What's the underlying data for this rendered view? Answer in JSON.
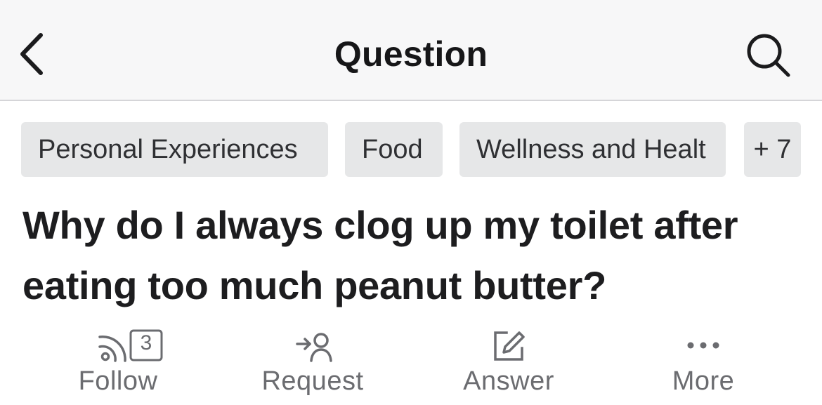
{
  "header": {
    "title": "Question",
    "back_icon": "chevron-left-icon",
    "search_icon": "search-icon"
  },
  "topics": [
    {
      "label": "Personal Experiences"
    },
    {
      "label": "Food"
    },
    {
      "label": "Wellness and Healt"
    },
    {
      "label": "+ 7"
    }
  ],
  "question": {
    "title": "Why do I always clog up my toilet after eating too much peanut butter?"
  },
  "actions": {
    "follow": {
      "label": "Follow",
      "count": "3",
      "icon": "follow-feed-icon"
    },
    "request": {
      "label": "Request",
      "icon": "request-person-icon"
    },
    "answer": {
      "label": "Answer",
      "icon": "answer-pencil-icon"
    },
    "more": {
      "label": "More",
      "icon": "more-dots-icon"
    }
  },
  "colors": {
    "header_bg": "#f7f7f8",
    "chip_bg": "#e6e7e8",
    "action_gray": "#6b6c70",
    "text_dark": "#1d1d1f"
  }
}
